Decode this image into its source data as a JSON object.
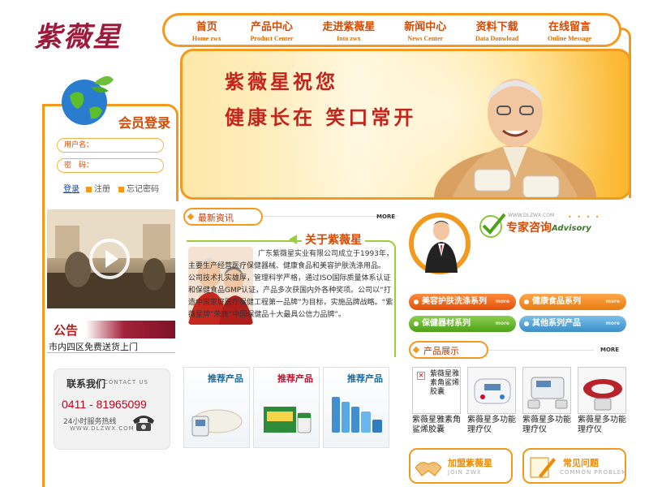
{
  "brand": {
    "logo_text": "紫薇星"
  },
  "nav": [
    {
      "cn": "首页",
      "en": "Home zwx"
    },
    {
      "cn": "产品中心",
      "en": "Product Center"
    },
    {
      "cn": "走进紫薇星",
      "en": "Into zwx"
    },
    {
      "cn": "新闻中心",
      "en": "News Center"
    },
    {
      "cn": "资料下载",
      "en": "Data Donwload"
    },
    {
      "cn": "在线留言",
      "en": "Online Message"
    }
  ],
  "banner": {
    "line1": "紫薇星祝您",
    "line2": "健康长在 笑口常开"
  },
  "member": {
    "title": "会员登录",
    "username_label": "用户名：",
    "password_label": "密　码：",
    "login": "登录",
    "register": "注册",
    "forgot": "忘记密码"
  },
  "notice": {
    "title": "公告",
    "text": "市内四区免费送货上门"
  },
  "contact": {
    "title": "联系我们",
    "title_en": "CONTACT US",
    "phone": "0411 - 81965099",
    "hours": "24小时服务热线",
    "web": "WWW.DLZWX.COM"
  },
  "news": {
    "title": "最新资讯",
    "more": "MORE"
  },
  "about": {
    "title": "关于紫薇星",
    "text": "广东紫薇星实业有限公司成立于1993年，主要生产经营医疗保健器械、健康食品和美容护肤洗涤用品。　公司技术扎实雄厚，管理科学严格，通过ISO国际质量体系认证和保健食品GMP认证，产品多次获国内外各种奖项。公司以“打造中国家庭医疗保健工程第一品牌”为目标，实施品牌战略。“紫薇星牌”荣膺“中国保健品十大最具公信力品牌”。"
  },
  "recommend": {
    "label": "推荐产品"
  },
  "advisory": {
    "title": "专家咨询",
    "title_en": "Advisory",
    "url": "WWW.DLZWX.COM",
    "dots": "• • • •"
  },
  "categories": [
    {
      "label": "美容护肤洗涤系列",
      "more": "more"
    },
    {
      "label": "健康食品系列",
      "more": "more"
    },
    {
      "label": "保健器材系列",
      "more": "more"
    },
    {
      "label": "其他系列产品",
      "more": "more"
    }
  ],
  "showcase": {
    "title": "产品展示",
    "more": "MORE",
    "products": [
      {
        "name": "紫薇星雅素角鲨烯胶囊",
        "alt": "紫薇星雅素角鲨烯胶囊"
      },
      {
        "name": "紫薇星多功能理疗仪"
      },
      {
        "name": "紫薇星多功能理疗仪"
      },
      {
        "name": "紫薇星多功能理疗仪"
      }
    ]
  },
  "bottom": {
    "join_cn": "加盟紫薇星",
    "join_en": "JOIN ZWX",
    "faq_cn": "常见问题",
    "faq_en": "COMMON PROBLEM"
  },
  "colors": {
    "accent": "#f39a1e",
    "brand": "#9b1b3b",
    "nav_text": "#d94a00",
    "link": "#1144aa"
  }
}
